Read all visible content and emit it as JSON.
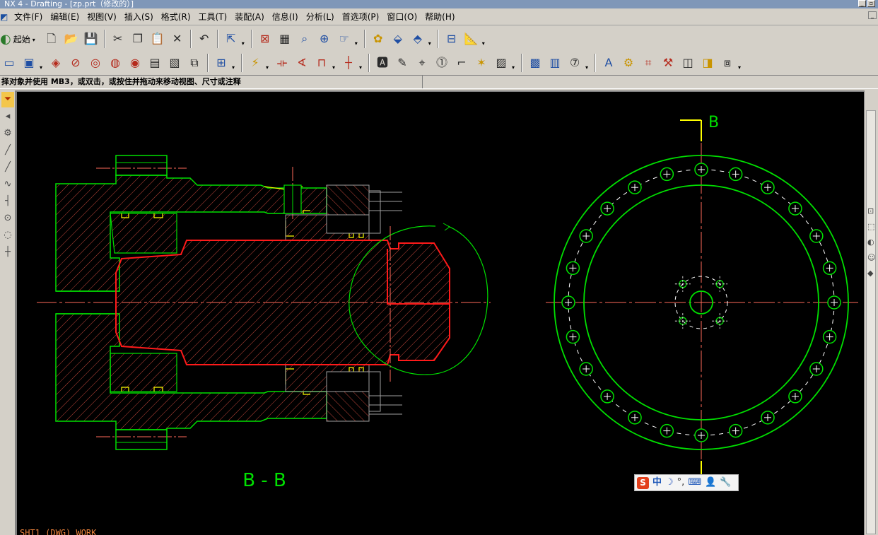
{
  "app": {
    "title": "NX 4 - Drafting - [zp.prt（修改的）]"
  },
  "menu": {
    "items": [
      {
        "label": "文件(F)"
      },
      {
        "label": "编辑(E)"
      },
      {
        "label": "视图(V)"
      },
      {
        "label": "插入(S)"
      },
      {
        "label": "格式(R)"
      },
      {
        "label": "工具(T)"
      },
      {
        "label": "装配(A)"
      },
      {
        "label": "信息(I)"
      },
      {
        "label": "分析(L)"
      },
      {
        "label": "首选项(P)"
      },
      {
        "label": "窗口(O)"
      },
      {
        "label": "帮助(H)"
      }
    ]
  },
  "toolbar": {
    "start_label": "起始"
  },
  "status": {
    "prompt": "择对象并使用 MB3，或双击，或按住并拖动来移动视图、尺寸或注释"
  },
  "drawing": {
    "section_label": "B - B",
    "view_label": "B",
    "sheet_label": "SHT1 (DWG) WORK",
    "colors": {
      "background": "#000000",
      "outline": "#00e000",
      "shaft": "#ff1a1a",
      "hatch": "#d04a3a",
      "centerline": "#ff6a5a",
      "yellow": "#ffff00",
      "gray": "#a0a0a0"
    }
  },
  "ime": {
    "logo": "S",
    "lang": "中",
    "moon": "☽",
    "punct": "°,"
  }
}
